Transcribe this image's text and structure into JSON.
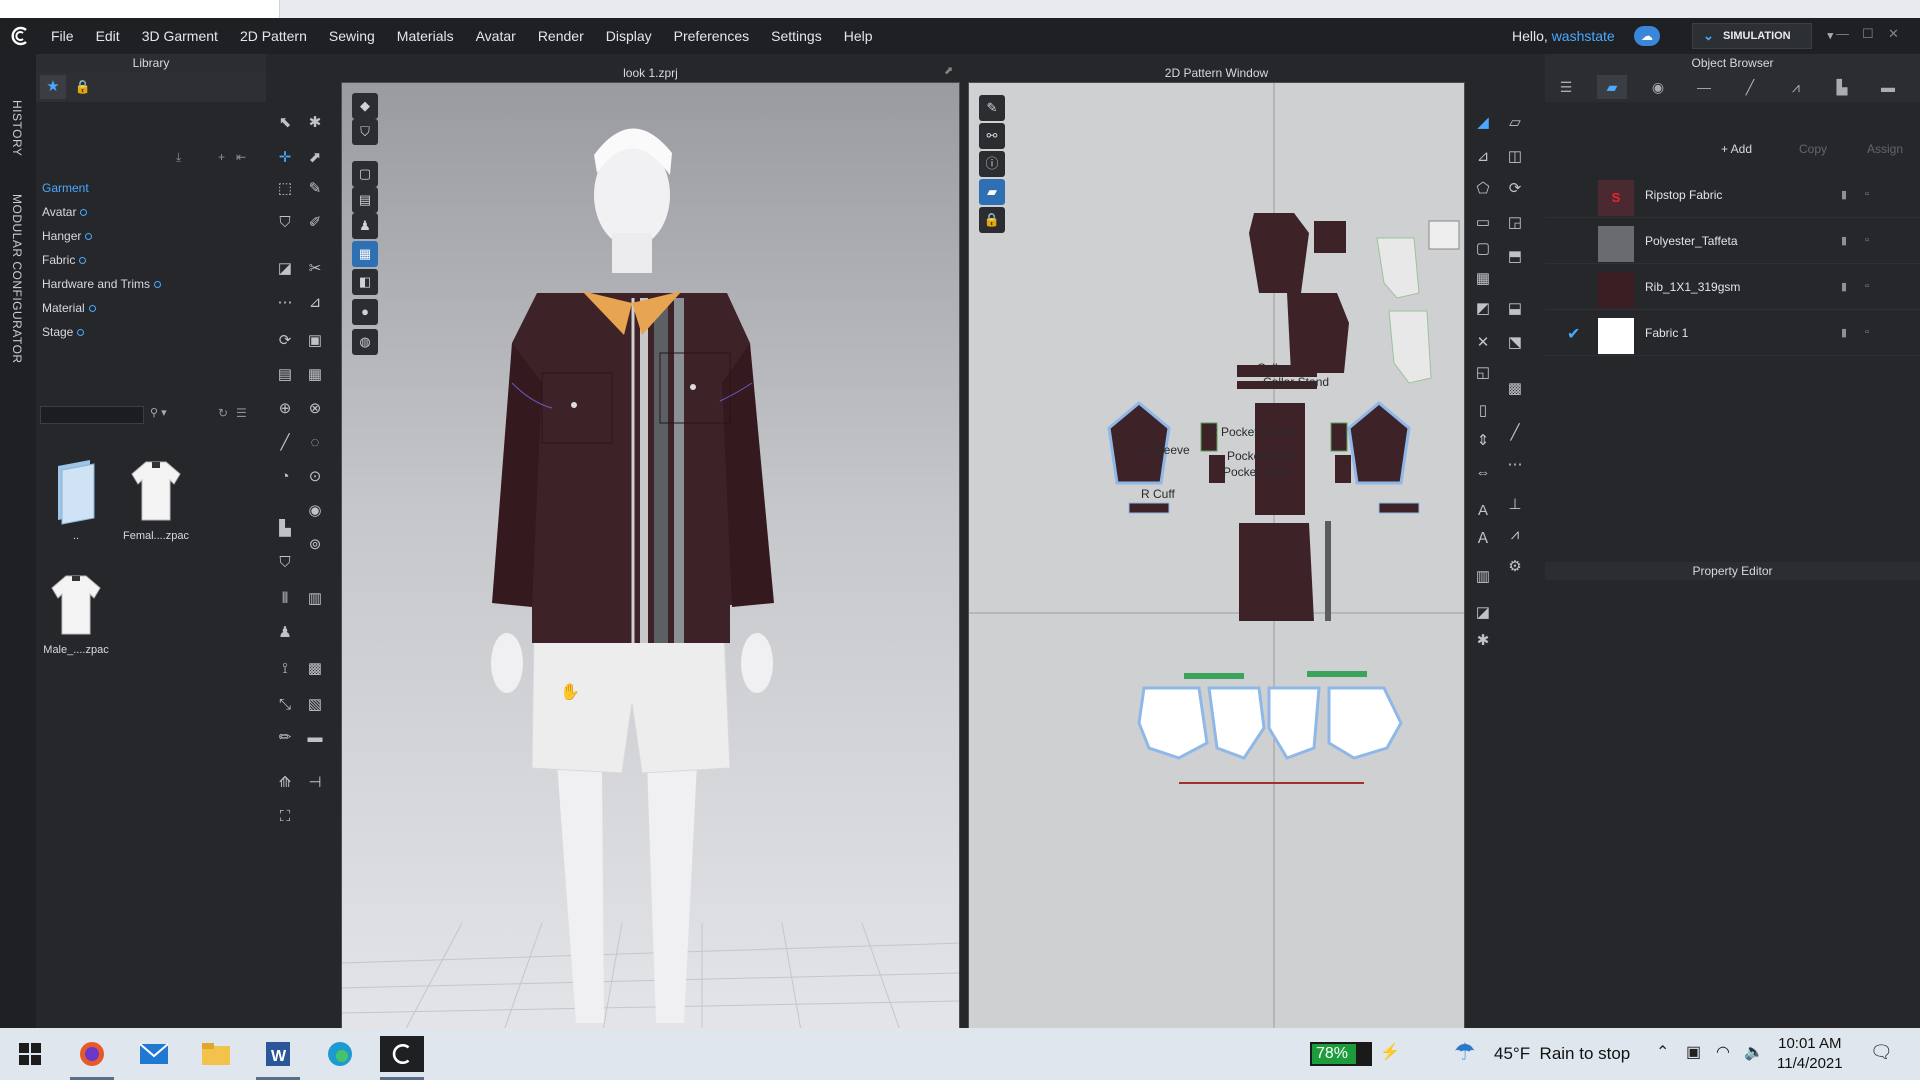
{
  "menubar": {
    "items": [
      "File",
      "Edit",
      "3D Garment",
      "2D Pattern",
      "Sewing",
      "Materials",
      "Avatar",
      "Render",
      "Display",
      "Preferences",
      "Settings",
      "Help"
    ],
    "hello_prefix": "Hello, ",
    "username": "washstate",
    "mode": "SIMULATION"
  },
  "side_tabs": {
    "history": "HISTORY",
    "modular": "MODULAR CONFIGURATOR"
  },
  "library": {
    "title": "Library",
    "items": [
      {
        "label": "Garment",
        "active": true
      },
      {
        "label": "Avatar"
      },
      {
        "label": "Hanger"
      },
      {
        "label": "Fabric"
      },
      {
        "label": "Hardware and Trims"
      },
      {
        "label": "Material"
      },
      {
        "label": "Stage"
      }
    ],
    "search_placeholder": "",
    "thumbnails": [
      {
        "label": ".."
      },
      {
        "label": "Femal....zpac"
      },
      {
        "label": "Male_....zpac"
      }
    ]
  },
  "view3d": {
    "title": "look 1.zprj"
  },
  "view2d": {
    "title": "2D Pattern Window",
    "labels": [
      "Collar",
      "Collar Stand",
      "R Pocket Under",
      "R Sleeve",
      "Pocket Over",
      "Pocket Flap",
      "R Cuff"
    ]
  },
  "object_browser": {
    "title": "Object Browser",
    "add_label": "+ Add",
    "copy_label": "Copy",
    "assign_label": "Assign",
    "fabrics": [
      {
        "name": "Ripstop Fabric",
        "color": "#4a2a30"
      },
      {
        "name": "Polyester_Taffeta",
        "color": "#6a6b6e"
      },
      {
        "name": "Rib_1X1_319gsm",
        "color": "#3a1e24"
      },
      {
        "name": "Fabric 1",
        "color": "#ffffff",
        "selected": true
      }
    ]
  },
  "property_editor": {
    "title": "Property Editor"
  },
  "taskbar": {
    "battery": "78%",
    "weather_temp": "45°F",
    "weather_text": "Rain to stop",
    "time": "10:01 AM",
    "date": "11/4/2021"
  },
  "colors": {
    "accent": "#4aa9ff",
    "garment": "#3d2328",
    "collar": "#e7a552"
  }
}
